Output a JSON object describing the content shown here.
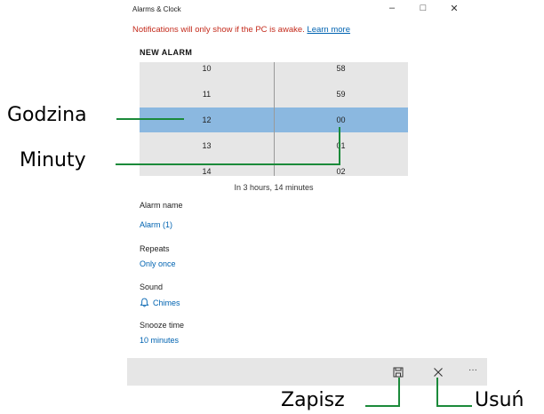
{
  "window": {
    "title": "Alarms & Clock",
    "controls": {
      "minimize": "–",
      "maximize": "□",
      "close": "✕"
    }
  },
  "notice": {
    "text": "Notifications will only show if the PC is awake.",
    "link": "Learn more"
  },
  "heading": "NEW ALARM",
  "time_picker": {
    "hours": [
      "10",
      "11",
      "12",
      "13",
      "14"
    ],
    "minutes": [
      "58",
      "59",
      "00",
      "01",
      "02"
    ],
    "selected_hour": "12",
    "selected_minute": "00"
  },
  "countdown": "In 3 hours, 14 minutes",
  "fields": {
    "alarm_name_label": "Alarm name",
    "alarm_name_value": "Alarm (1)",
    "repeats_label": "Repeats",
    "repeats_value": "Only once",
    "sound_label": "Sound",
    "sound_value": "Chimes",
    "snooze_label": "Snooze time",
    "snooze_value": "10 minutes"
  },
  "command_bar": {
    "more": "···"
  },
  "annotations": {
    "godzina": "Godzina",
    "minuty": "Minuty",
    "zapisz": "Zapisz",
    "usun": "Usuń"
  },
  "colors": {
    "selection": "#8bb8e0",
    "picker_bg": "#e6e6e6",
    "accent": "#0063b1",
    "notice": "#c42b1c",
    "annotation_line": "#1b8a3a"
  }
}
